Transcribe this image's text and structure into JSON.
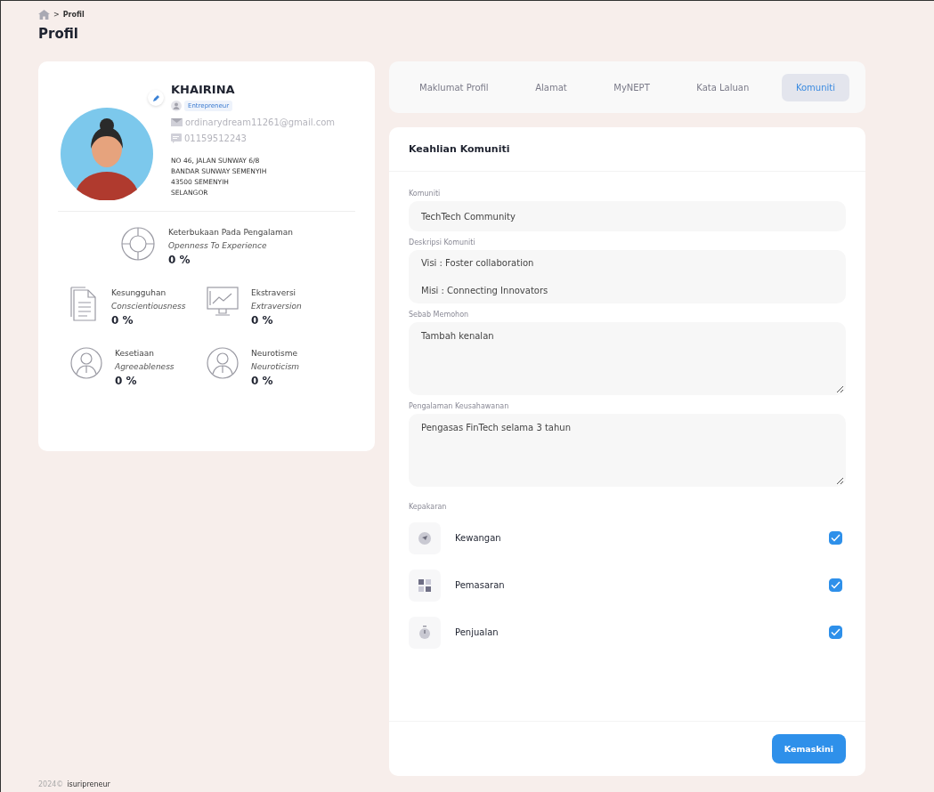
{
  "breadcrumb": {
    "separator": ">",
    "current": "Profil"
  },
  "page_title": "Profil",
  "profile": {
    "name": "KHAIRINA",
    "role": "Entrepreneur",
    "email": "ordinarydream11261@gmail.com",
    "phone": "01159512243",
    "address": [
      "NO 46, JALAN SUNWAY 6/8",
      "BANDAR SUNWAY SEMENYIH",
      "43500 SEMENYIH",
      "SELANGOR"
    ]
  },
  "traits": [
    {
      "kind": "donut",
      "label": "Keterbukaan Pada Pengalaman",
      "english": "Openness To Experience",
      "value": "0 %"
    },
    {
      "kind": "document",
      "label": "Kesungguhan",
      "english": "Conscientiousness",
      "value": "0 %"
    },
    {
      "kind": "monitor",
      "label": "Ekstraversi",
      "english": "Extraversion",
      "value": "0 %"
    },
    {
      "kind": "person",
      "label": "Kesetiaan",
      "english": "Agreeableness",
      "value": "0 %"
    },
    {
      "kind": "person",
      "label": "Neurotisme",
      "english": "Neuroticism",
      "value": "0 %"
    }
  ],
  "tabs": [
    {
      "label": "Maklumat Profil",
      "selected": false
    },
    {
      "label": "Alamat",
      "selected": false
    },
    {
      "label": "MyNEPT",
      "selected": false
    },
    {
      "label": "Kata Laluan",
      "selected": false
    },
    {
      "label": "Komuniti",
      "selected": true
    }
  ],
  "form": {
    "title": "Keahlian Komuniti",
    "fields": [
      {
        "kind": "input",
        "label": "Komuniti",
        "value": "TechTech Community"
      },
      {
        "kind": "lines",
        "label": "Deskripsi Komuniti",
        "lines": [
          "Visi : Foster collaboration",
          "Misi : Connecting Innovators"
        ]
      },
      {
        "kind": "textarea",
        "label": "Sebab Memohon",
        "value": "Tambah kenalan"
      },
      {
        "kind": "textarea",
        "label": "Pengalaman Keusahawanan",
        "value": "Pengasas FinTech selama 3 tahun"
      }
    ],
    "expertise_label": "Kepakaran",
    "expertise": [
      {
        "kind": "compass",
        "label": "Kewangan",
        "checked": true
      },
      {
        "kind": "grid",
        "label": "Pemasaran",
        "checked": true
      },
      {
        "kind": "stopwatch",
        "label": "Penjualan",
        "checked": true
      }
    ],
    "submit": "Kemaskini"
  },
  "footer": {
    "year": "2024©",
    "brand": "isuripreneur"
  }
}
